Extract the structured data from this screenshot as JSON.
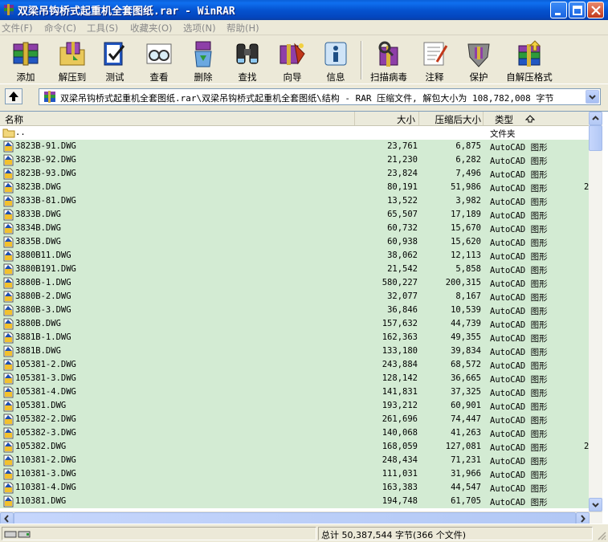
{
  "window": {
    "title": "双梁吊钩桥式起重机全套图纸.rar - WinRAR"
  },
  "menu": [
    {
      "label": "文件(F)"
    },
    {
      "label": "命令(C)"
    },
    {
      "label": "工具(S)"
    },
    {
      "label": "收藏夹(O)"
    },
    {
      "label": "选项(N)"
    },
    {
      "label": "帮助(H)"
    }
  ],
  "toolbar": [
    {
      "label": "添加",
      "icon": "add-books-icon"
    },
    {
      "label": "解压到",
      "icon": "extract-folder-icon"
    },
    {
      "label": "测试",
      "icon": "test-check-icon"
    },
    {
      "label": "查看",
      "icon": "view-glasses-icon"
    },
    {
      "label": "删除",
      "icon": "delete-recycle-icon"
    },
    {
      "label": "查找",
      "icon": "find-binoculars-icon"
    },
    {
      "label": "向导",
      "icon": "wizard-icon"
    },
    {
      "label": "信息",
      "icon": "info-icon"
    },
    {
      "label": "扫描病毒",
      "icon": "virus-scan-icon"
    },
    {
      "label": "注释",
      "icon": "comment-icon"
    },
    {
      "label": "保护",
      "icon": "protect-shield-icon"
    },
    {
      "label": "自解压格式",
      "icon": "sfx-icon"
    }
  ],
  "address": {
    "path": "双梁吊钩桥式起重机全套图纸.rar\\双梁吊钩桥式起重机全套图纸\\结构 - RAR 压缩文件, 解包大小为 108,782,008 字节"
  },
  "columns": {
    "name": "名称",
    "size": "大小",
    "packed": "压缩后大小",
    "type": "类型"
  },
  "parent_row": {
    "name": "..",
    "type": "文件夹"
  },
  "files": [
    {
      "name": "3823B-91.DWG",
      "size": "23,761",
      "packed": "6,875",
      "type": "AutoCAD 图形",
      "extra": ""
    },
    {
      "name": "3823B-92.DWG",
      "size": "21,230",
      "packed": "6,282",
      "type": "AutoCAD 图形",
      "extra": ""
    },
    {
      "name": "3823B-93.DWG",
      "size": "23,824",
      "packed": "7,496",
      "type": "AutoCAD 图形",
      "extra": ""
    },
    {
      "name": "3823B.DWG",
      "size": "80,191",
      "packed": "51,986",
      "type": "AutoCAD 图形",
      "extra": "2"
    },
    {
      "name": "3833B-81.DWG",
      "size": "13,522",
      "packed": "3,982",
      "type": "AutoCAD 图形",
      "extra": ""
    },
    {
      "name": "3833B.DWG",
      "size": "65,507",
      "packed": "17,189",
      "type": "AutoCAD 图形",
      "extra": ""
    },
    {
      "name": "3834B.DWG",
      "size": "60,732",
      "packed": "15,670",
      "type": "AutoCAD 图形",
      "extra": ""
    },
    {
      "name": "3835B.DWG",
      "size": "60,938",
      "packed": "15,620",
      "type": "AutoCAD 图形",
      "extra": ""
    },
    {
      "name": "3880B11.DWG",
      "size": "38,062",
      "packed": "12,113",
      "type": "AutoCAD 图形",
      "extra": ""
    },
    {
      "name": "3880B191.DWG",
      "size": "21,542",
      "packed": "5,858",
      "type": "AutoCAD 图形",
      "extra": ""
    },
    {
      "name": "3880B-1.DWG",
      "size": "580,227",
      "packed": "200,315",
      "type": "AutoCAD 图形",
      "extra": ""
    },
    {
      "name": "3880B-2.DWG",
      "size": "32,077",
      "packed": "8,167",
      "type": "AutoCAD 图形",
      "extra": ""
    },
    {
      "name": "3880B-3.DWG",
      "size": "36,846",
      "packed": "10,539",
      "type": "AutoCAD 图形",
      "extra": ""
    },
    {
      "name": "3880B.DWG",
      "size": "157,632",
      "packed": "44,739",
      "type": "AutoCAD 图形",
      "extra": ""
    },
    {
      "name": "3881B-1.DWG",
      "size": "162,363",
      "packed": "49,355",
      "type": "AutoCAD 图形",
      "extra": ""
    },
    {
      "name": "3881B.DWG",
      "size": "133,180",
      "packed": "39,834",
      "type": "AutoCAD 图形",
      "extra": ""
    },
    {
      "name": "105381-2.DWG",
      "size": "243,884",
      "packed": "68,572",
      "type": "AutoCAD 图形",
      "extra": ""
    },
    {
      "name": "105381-3.DWG",
      "size": "128,142",
      "packed": "36,665",
      "type": "AutoCAD 图形",
      "extra": ""
    },
    {
      "name": "105381-4.DWG",
      "size": "141,831",
      "packed": "37,325",
      "type": "AutoCAD 图形",
      "extra": ""
    },
    {
      "name": "105381.DWG",
      "size": "193,212",
      "packed": "60,901",
      "type": "AutoCAD 图形",
      "extra": ""
    },
    {
      "name": "105382-2.DWG",
      "size": "261,696",
      "packed": "74,447",
      "type": "AutoCAD 图形",
      "extra": ""
    },
    {
      "name": "105382-3.DWG",
      "size": "140,068",
      "packed": "41,263",
      "type": "AutoCAD 图形",
      "extra": ""
    },
    {
      "name": "105382.DWG",
      "size": "168,059",
      "packed": "127,081",
      "type": "AutoCAD 图形",
      "extra": "2"
    },
    {
      "name": "110381-2.DWG",
      "size": "248,434",
      "packed": "71,231",
      "type": "AutoCAD 图形",
      "extra": ""
    },
    {
      "name": "110381-3.DWG",
      "size": "111,031",
      "packed": "31,966",
      "type": "AutoCAD 图形",
      "extra": ""
    },
    {
      "name": "110381-4.DWG",
      "size": "163,383",
      "packed": "44,547",
      "type": "AutoCAD 图形",
      "extra": ""
    },
    {
      "name": "110381.DWG",
      "size": "194,748",
      "packed": "61,705",
      "type": "AutoCAD 图形",
      "extra": ""
    }
  ],
  "status": {
    "total": "总计 50,387,544 字节(366 个文件)"
  },
  "colors": {
    "row_highlight": "#D3EBD3",
    "title_bar": "#0553D0"
  }
}
